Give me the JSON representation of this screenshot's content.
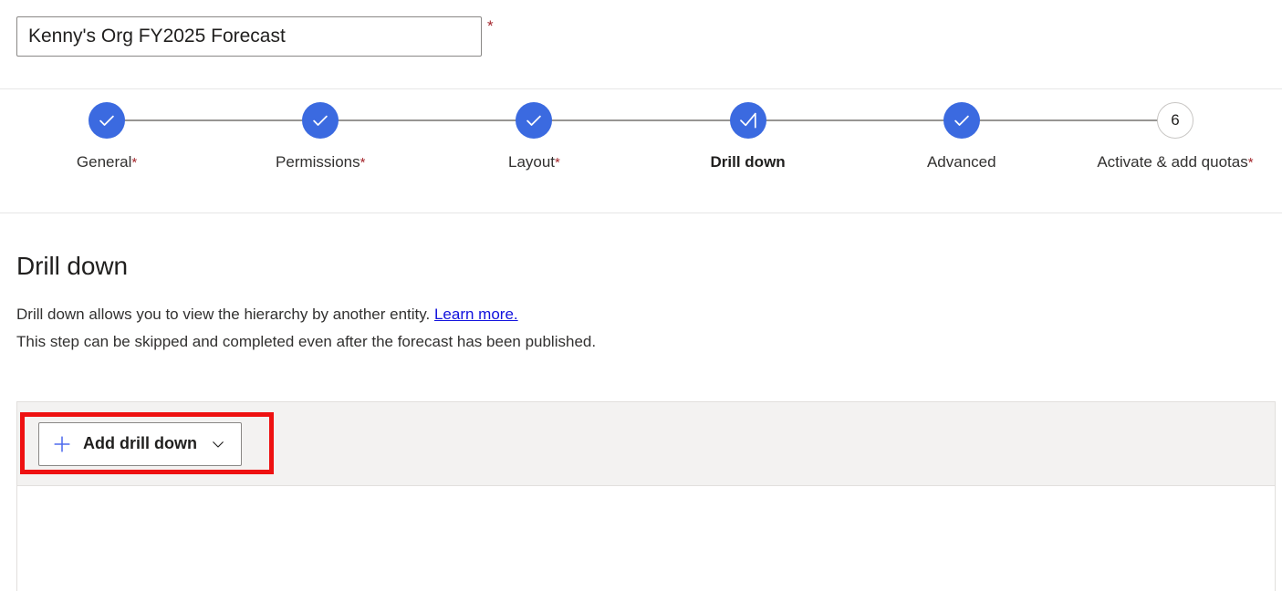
{
  "header": {
    "title_input_value": "Kenny's Org FY2025 Forecast",
    "title_input_placeholder": "Forecast name",
    "required_marker": "*"
  },
  "stepper": {
    "steps": [
      {
        "index": "1",
        "label": "General",
        "required_marker": "*",
        "state": "completed",
        "icon": "check-icon"
      },
      {
        "index": "2",
        "label": "Permissions",
        "required_marker": "*",
        "state": "completed",
        "icon": "check-icon"
      },
      {
        "index": "3",
        "label": "Layout",
        "required_marker": "*",
        "state": "completed",
        "icon": "check-icon"
      },
      {
        "index": "4",
        "label": "Drill down",
        "required_marker": "",
        "state": "current",
        "icon": "check-progress-icon"
      },
      {
        "index": "5",
        "label": "Advanced",
        "required_marker": "",
        "state": "completed",
        "icon": "check-icon"
      },
      {
        "index": "6",
        "label": "Activate & add quotas",
        "required_marker": "*",
        "state": "pending",
        "icon": "number-6"
      }
    ]
  },
  "main": {
    "page_title": "Drill down",
    "description_line1_before_link": "Drill down allows you to view the hierarchy by another entity. ",
    "description_link_text": "Learn more.",
    "description_line2": "This step can be skipped and completed even after the forecast has been published."
  },
  "panel": {
    "toolbar": {
      "add_drill_down_label": "Add drill down",
      "plus_icon": "plus-icon",
      "chevron_icon": "chevron-down-icon"
    }
  },
  "colors": {
    "step_completed": "#3b6ae0",
    "step_connector": "#979593",
    "required_asterisk": "#a4262c",
    "link": "#1212dd",
    "plus_icon": "#4f6bed",
    "toolbar_background": "#f3f2f1",
    "annotation_highlight": "#ee1111"
  }
}
